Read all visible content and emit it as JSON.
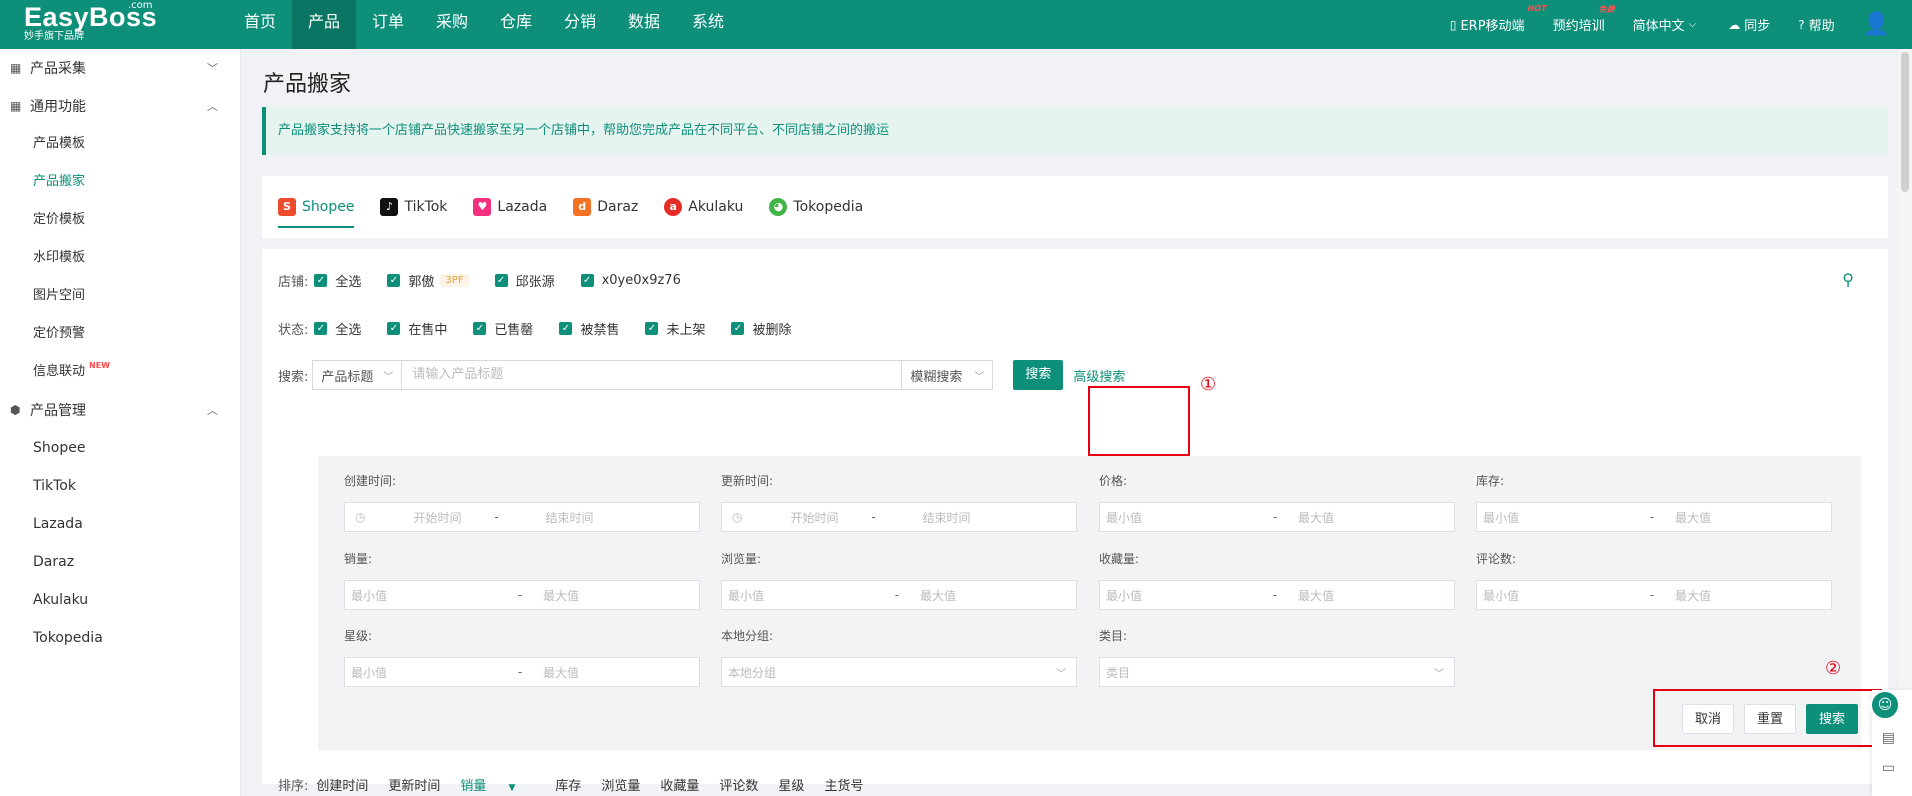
{
  "app": {
    "logo": "EasyBoss",
    "logo_com": ".com",
    "logo_sub": "妙手旗下品牌",
    "nav": [
      "首页",
      "产品",
      "订单",
      "采购",
      "仓库",
      "分销",
      "数据",
      "系统"
    ],
    "active_nav": "产品",
    "right": {
      "erp": "ERP移动端",
      "erp_badge": "HOT",
      "training": "预约培训",
      "training_badge": "免费",
      "lang": "简体中文",
      "sync": "同步",
      "help": "帮助"
    },
    "colors": {
      "accent": "#0d8f7a",
      "highlight_red": "#e60012"
    }
  },
  "sidebar": {
    "group1": "产品采集",
    "group2": "通用功能",
    "common_items": [
      "产品模板",
      "产品搬家",
      "定价模板",
      "水印模板",
      "图片空间",
      "定价预警",
      "信息联动"
    ],
    "new_tag": "NEW",
    "group3": "产品管理",
    "manage_items": [
      "Shopee",
      "TikTok",
      "Lazada",
      "Daraz",
      "Akulaku",
      "Tokopedia"
    ],
    "active_item": "产品搬家"
  },
  "page": {
    "title": "产品搬家",
    "notice": "产品搬家支持将一个店铺产品快速搬家至另一个店铺中，帮助您完成产品在不同平台、不同店铺之间的搬运"
  },
  "platform_tabs": [
    "Shopee",
    "TikTok",
    "Lazada",
    "Daraz",
    "Akulaku",
    "Tokopedia"
  ],
  "filters": {
    "shop_label": "店铺:",
    "shops": [
      "全选",
      "郭傲",
      "邱张源",
      "x0ye0x9z76"
    ],
    "shop_tag": "3PF",
    "status_label": "状态:",
    "statuses": [
      "全选",
      "在售中",
      "已售罄",
      "被禁售",
      "未上架",
      "被删除"
    ],
    "search_label": "搜索:",
    "search_field": "产品标题",
    "search_placeholder": "请输入产品标题",
    "match_mode": "模糊搜索",
    "search_button": "搜索",
    "advanced_link": "高级搜索",
    "marker1": "①",
    "marker2": "②"
  },
  "advanced": {
    "created": "创建时间:",
    "updated": "更新时间:",
    "price": "价格:",
    "stock": "库存:",
    "sales": "销量:",
    "views": "浏览量:",
    "favorites": "收藏量:",
    "reviews": "评论数:",
    "rating": "星级:",
    "local_group": "本地分组:",
    "category": "类目:",
    "start_time": "开始时间",
    "end_time": "结束时间",
    "min": "最小值",
    "max": "最大值",
    "local_group_placeholder": "本地分组",
    "category_placeholder": "类目",
    "cancel": "取消",
    "reset": "重置",
    "search": "搜索"
  },
  "sort": {
    "label": "排序:",
    "options": [
      "创建时间",
      "更新时间",
      "销量",
      "库存",
      "浏览量",
      "收藏量",
      "评论数",
      "星级",
      "主货号"
    ],
    "active": "销量"
  }
}
